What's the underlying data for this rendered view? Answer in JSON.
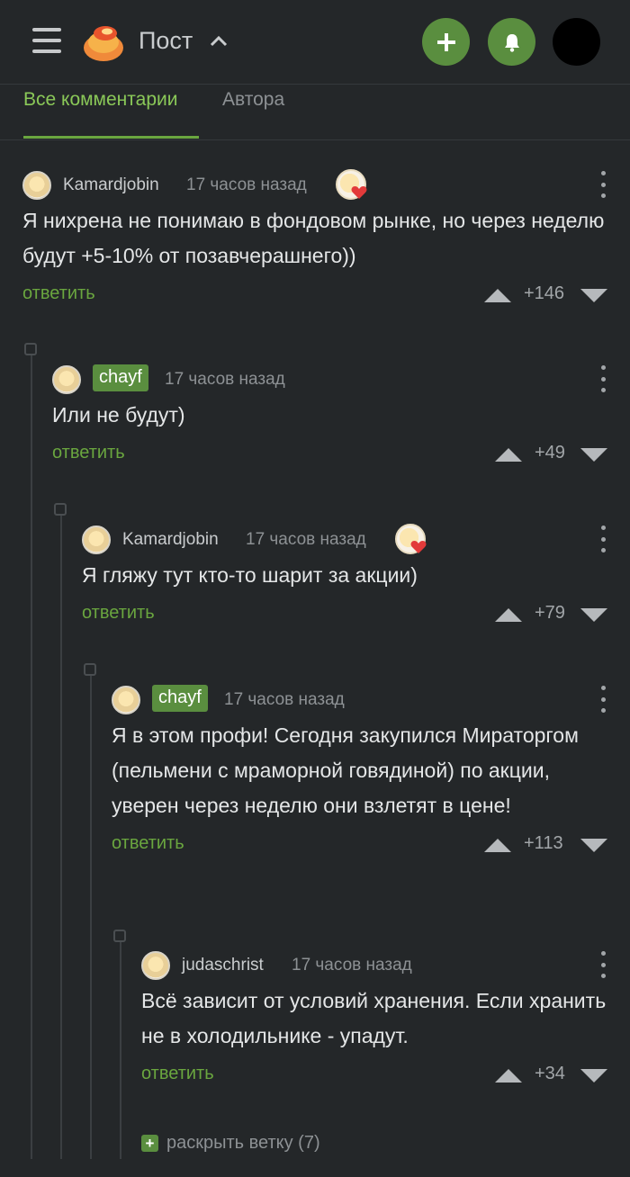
{
  "header": {
    "title": "Пост",
    "icons": {
      "menu": "hamburger-icon",
      "logo": "pikabu-logo",
      "expand": "chevron-up-icon",
      "add": "plus-icon",
      "notifications": "bell-icon"
    },
    "colors": {
      "accent": "#5a8e3f",
      "background": "#242729",
      "link": "#6aa63f"
    }
  },
  "tabs": [
    {
      "label": "Все комментарии",
      "active": true
    },
    {
      "label": "Автора",
      "active": false
    }
  ],
  "comments": [
    {
      "author": "Kamardjobin",
      "time": "17 часов назад",
      "text": "Я нихрена не понимаю в фондовом рынке, но через неделю будут +5-10% от позавчерашнего))",
      "reply": "ответить",
      "rating": "+146",
      "author_badge": false,
      "heart_badge": true
    },
    {
      "author": "chayf",
      "time": "17 часов назад",
      "text": "Или не будут)",
      "reply": "ответить",
      "rating": "+49",
      "author_badge": true,
      "heart_badge": false
    },
    {
      "author": "Kamardjobin",
      "time": "17 часов назад",
      "text": "Я гляжу тут кто-то шарит за акции)",
      "reply": "ответить",
      "rating": "+79",
      "author_badge": false,
      "heart_badge": true
    },
    {
      "author": "chayf",
      "time": "17 часов назад",
      "text": "Я в этом профи! Сегодня закупился Мираторгом (пельмени с мраморной говядиной) по акции, уверен через неделю они взлетят в цене!",
      "reply": "ответить",
      "rating": "+113",
      "author_badge": true,
      "heart_badge": false
    },
    {
      "author": "judaschrist",
      "time": "17 часов назад",
      "text": "Всё зависит от условий хранения. Если хранить не в холодильнике - упадут.",
      "reply": "ответить",
      "rating": "+34",
      "author_badge": false,
      "heart_badge": false
    }
  ],
  "expand_branch": {
    "label": "раскрыть ветку (7)"
  }
}
